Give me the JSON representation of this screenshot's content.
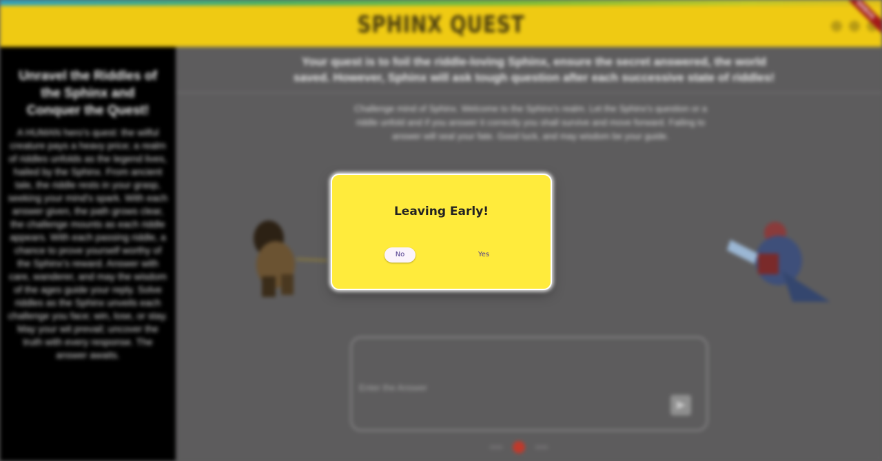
{
  "app": {
    "title": "SPHINX QUEST",
    "debug_label": "DEBUG"
  },
  "sidebar": {
    "title": "Unravel the Riddles of the Sphinx and Conquer the Quest!",
    "body": "A HUMAN hero's quest: the wilful creature pays a heavy price; a realm of riddles unfolds as the legend lives, hailed by the Sphinx. From ancient tale, the riddle rests in your grasp, seeking your mind's spark. With each answer given, the path grows clear, the challenge mounts as each riddle appears. With each passing riddle, a chance to prove yourself worthy of the Sphinx's reward. Answer with care, wanderer, and may the wisdom of the ages guide your reply. Solve riddles as the Sphinx unveils each challenge you face; win, lose, or stay. May your wit prevail; uncover the truth with every response. The answer awaits."
  },
  "main": {
    "headline": "Your quest is to foil the riddle-loving Sphinx, ensure the secret answered, the world saved. However, Sphinx will ask tough question after each successive state of riddles!",
    "intro": "Challenge mind of Sphinx. Welcome to the Sphinx's realm. Let the Sphinx's question or a riddle unfold and if you answer it correctly you shall survive and move forward. Failing to answer will seal your fate. Good luck, and may wisdom be your guide.",
    "chat_placeholder": "Enter the Answer"
  },
  "dialog": {
    "title": "Leaving Early!",
    "no_label": "No",
    "yes_label": "Yes"
  },
  "colors": {
    "appbar": "#efca13",
    "dialog_bg": "#ffeb3c",
    "button_text": "#4d3a8c",
    "overlay": "#5d5c5d",
    "pager_active": "#c0392b"
  }
}
